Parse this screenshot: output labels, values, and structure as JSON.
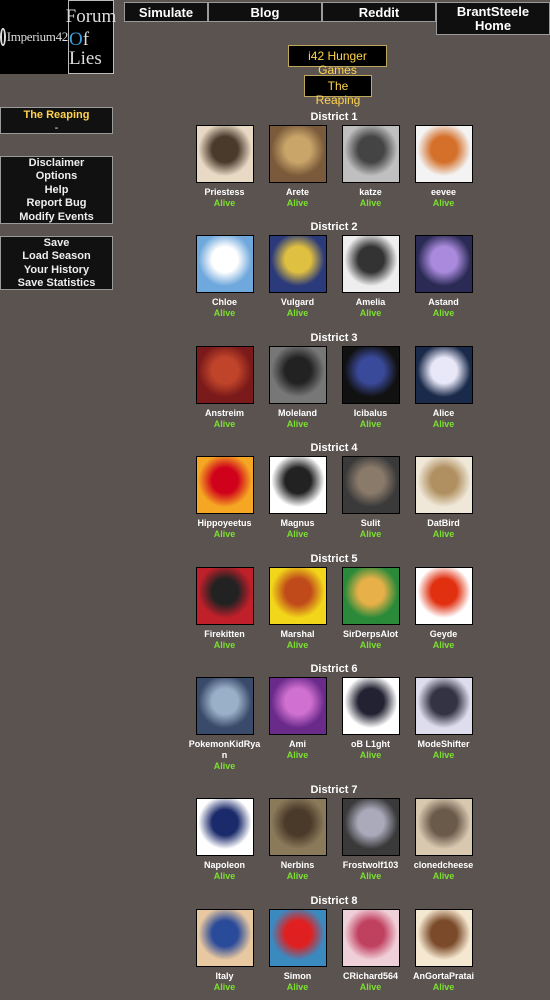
{
  "logo": {
    "part1": "Imperium42",
    "part2_line1": "Forum",
    "part2_line2_o": "O",
    "part2_line2_rest": "f Lies"
  },
  "nav": {
    "simulate": "Simulate",
    "blog": "Blog",
    "reddit": "Reddit",
    "home_line1": "BrantSteele",
    "home_line2": "Home"
  },
  "sidebar": {
    "phase_title": "The Reaping",
    "phase_sub": "-",
    "menu1": [
      "Disclaimer",
      "Options",
      "Help",
      "Report Bug",
      "Modify Events"
    ],
    "menu2": [
      "Save",
      "Load Season",
      "Your History",
      "Save Statistics"
    ]
  },
  "main": {
    "game_title": "i42 Hunger Games",
    "event_title": "The Reaping"
  },
  "districts": [
    {
      "name": "District 1",
      "tributes": [
        {
          "name": "Priestess",
          "status": "Alive"
        },
        {
          "name": "Arete",
          "status": "Alive"
        },
        {
          "name": "katze",
          "status": "Alive"
        },
        {
          "name": "eevee",
          "status": "Alive"
        }
      ]
    },
    {
      "name": "District 2",
      "tributes": [
        {
          "name": "Chloe",
          "status": "Alive"
        },
        {
          "name": "Vulgard",
          "status": "Alive"
        },
        {
          "name": "Amelia",
          "status": "Alive"
        },
        {
          "name": "Astand",
          "status": "Alive"
        }
      ]
    },
    {
      "name": "District 3",
      "tributes": [
        {
          "name": "Anstreim",
          "status": "Alive"
        },
        {
          "name": "Moleland",
          "status": "Alive"
        },
        {
          "name": "Icibalus",
          "status": "Alive"
        },
        {
          "name": "Alice",
          "status": "Alive"
        }
      ]
    },
    {
      "name": "District 4",
      "tributes": [
        {
          "name": "Hippoyeetus",
          "status": "Alive"
        },
        {
          "name": "Magnus",
          "status": "Alive"
        },
        {
          "name": "Sulit",
          "status": "Alive"
        },
        {
          "name": "DatBird",
          "status": "Alive"
        }
      ]
    },
    {
      "name": "District 5",
      "tributes": [
        {
          "name": "Firekitten",
          "status": "Alive"
        },
        {
          "name": "Marshal",
          "status": "Alive"
        },
        {
          "name": "SirDerpsAlot",
          "status": "Alive"
        },
        {
          "name": "Geyde",
          "status": "Alive"
        }
      ]
    },
    {
      "name": "District 6",
      "tributes": [
        {
          "name": "PokemonKidRyan",
          "status": "Alive"
        },
        {
          "name": "Ami",
          "status": "Alive"
        },
        {
          "name": "oB L1ght",
          "status": "Alive"
        },
        {
          "name": "ModeShifter",
          "status": "Alive"
        }
      ]
    },
    {
      "name": "District 7",
      "tributes": [
        {
          "name": "Napoleon",
          "status": "Alive"
        },
        {
          "name": "Nerbins",
          "status": "Alive"
        },
        {
          "name": "Frostwolf103",
          "status": "Alive"
        },
        {
          "name": "clonedcheese",
          "status": "Alive"
        }
      ]
    },
    {
      "name": "District 8",
      "tributes": [
        {
          "name": "Italy",
          "status": "Alive"
        },
        {
          "name": "Simon",
          "status": "Alive"
        },
        {
          "name": "CRichard564",
          "status": "Alive"
        },
        {
          "name": "AnGortaPratai",
          "status": "Alive"
        }
      ]
    }
  ],
  "colors": {
    "background": "#5b5350",
    "alive": "#7be030",
    "title_text": "#ffd34d"
  }
}
